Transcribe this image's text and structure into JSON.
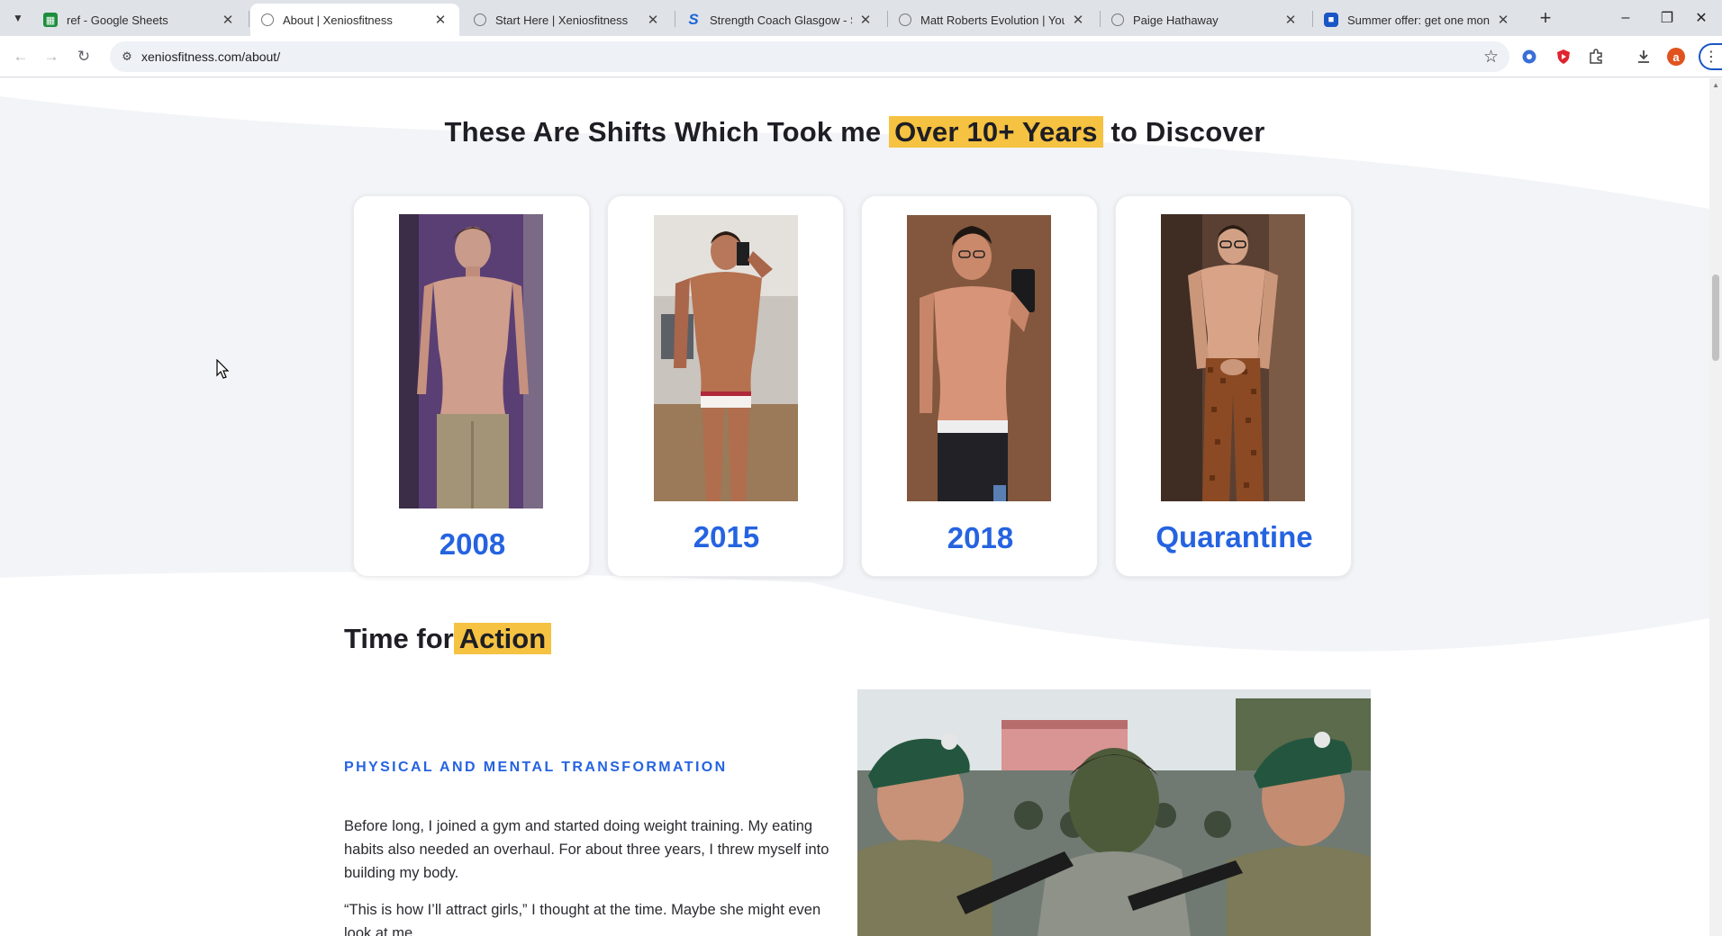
{
  "browser": {
    "tabs": [
      {
        "title": "ref - Google Sheets",
        "favicon": "sheets-icon",
        "active": false
      },
      {
        "title": "About | Xeniosfitness",
        "favicon": "globe-icon",
        "active": true
      },
      {
        "title": "Start Here | Xeniosfitness",
        "favicon": "globe-icon",
        "active": false
      },
      {
        "title": "Strength Coach Glasgow - Simp",
        "favicon": "s-logo-icon",
        "active": false
      },
      {
        "title": "Matt Roberts Evolution | Young",
        "favicon": "globe-icon",
        "active": false
      },
      {
        "title": "Paige Hathaway",
        "favicon": "globe-icon",
        "active": false
      },
      {
        "title": "Summer offer: get one month f",
        "favicon": "bookmark-blue-icon",
        "active": false
      }
    ],
    "url": "xeniosfitness.com/about/",
    "profile_initial": "a"
  },
  "page": {
    "shifts_heading": {
      "before": "These Are Shifts Which Took me ",
      "highlight": "Over 10+ Years",
      "after": " to Discover"
    },
    "timeline_cards": [
      {
        "label": "2008",
        "photo": "shirtless-teen-photo"
      },
      {
        "label": "2015",
        "photo": "bodybuilder-selfie-photo"
      },
      {
        "label": "2018",
        "photo": "mirror-selfie-photo"
      },
      {
        "label": "Quarantine",
        "photo": "standing-patterned-pants-photo"
      }
    ],
    "action_heading": {
      "before": "Time for",
      "highlight": "Action"
    },
    "action_subheading": "PHYSICAL AND MENTAL TRANSFORMATION",
    "paragraphs": [
      "Before long, I joined a gym and started doing weight training. My eating habits also needed an overhaul. For about three years, I threw myself into building my body.",
      "“This is how I’ll attract girls,” I thought at the time. Maybe she might even look at me."
    ],
    "accent_color": "#2563e0",
    "highlight_color": "#f5c242"
  }
}
